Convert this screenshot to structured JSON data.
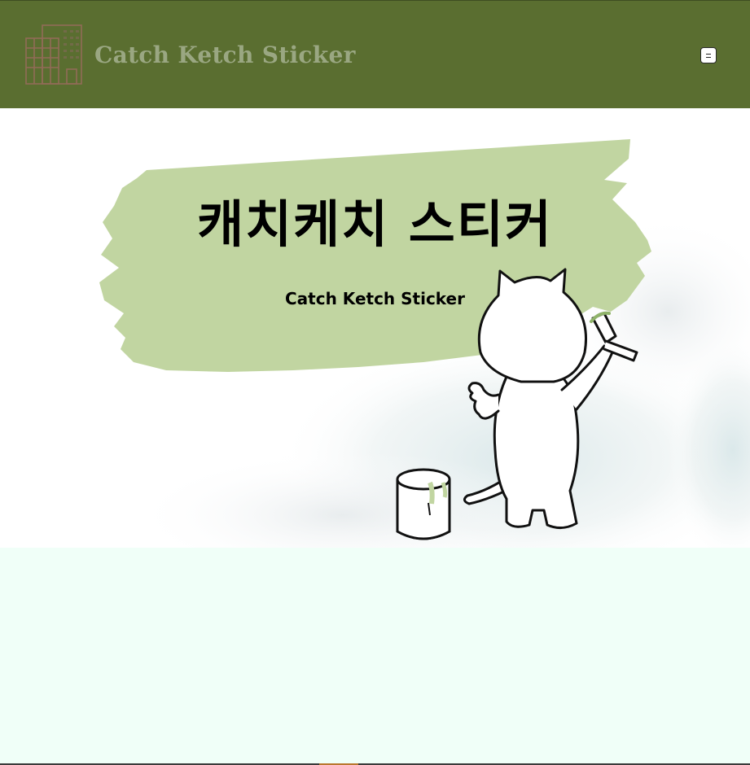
{
  "header": {
    "logo_text": "Catch Ketch Sticker",
    "logo_icon": "building-icon",
    "menu_icon": "hamburger-menu-icon",
    "background_color": "#5a6e30"
  },
  "hero": {
    "title": "캐치케치 스티커",
    "subtitle": "Catch Ketch Sticker",
    "brush_color": "#c1d5a1",
    "illustration": "cat-painting-illustration"
  },
  "page": {
    "background_color": "#f0fff8"
  }
}
